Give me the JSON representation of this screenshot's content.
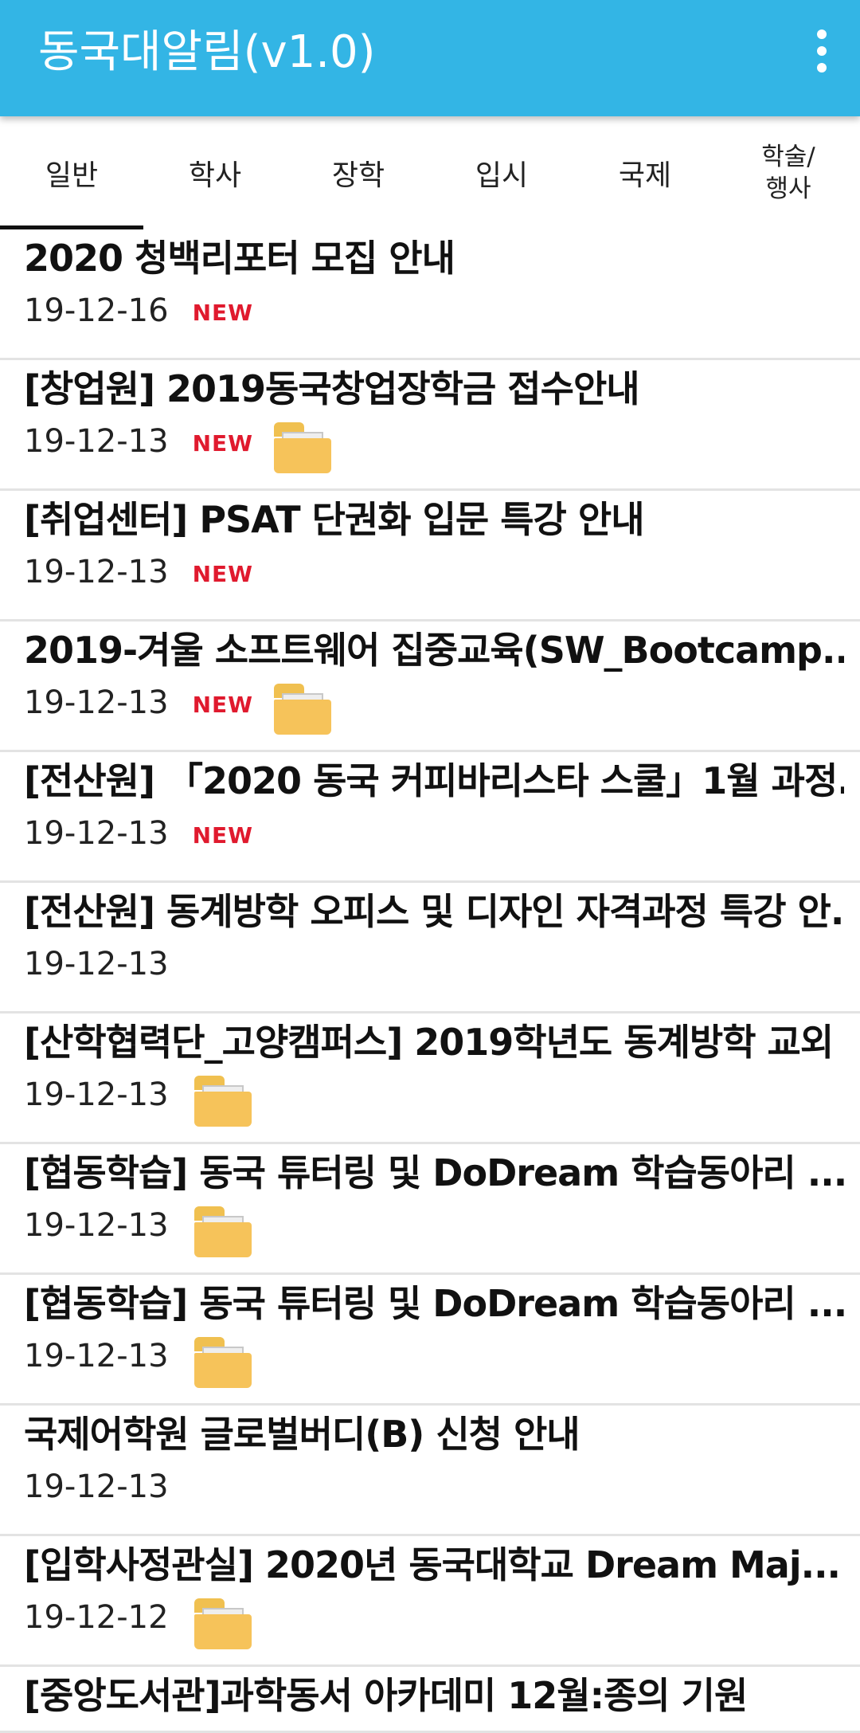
{
  "app": {
    "title": "동국대알림(v1.0)",
    "theme_color": "#33b5e5"
  },
  "menu": {
    "icon": "more-vert-icon"
  },
  "tabs": [
    {
      "label": "일반",
      "selected": true
    },
    {
      "label": "학사",
      "selected": false
    },
    {
      "label": "장학",
      "selected": false
    },
    {
      "label": "입시",
      "selected": false
    },
    {
      "label": "국제",
      "selected": false
    },
    {
      "label": "학술/\n행사",
      "selected": false
    }
  ],
  "notices": [
    {
      "title": "2020 청백리포터 모집 안내",
      "date": "19-12-16",
      "new": true,
      "attachment": false
    },
    {
      "title": "[창업원] 2019동국창업장학금 접수안내",
      "date": "19-12-13",
      "new": true,
      "attachment": true
    },
    {
      "title": "[취업센터] PSAT 단권화 입문 특강 안내",
      "date": "19-12-13",
      "new": true,
      "attachment": false
    },
    {
      "title": "2019-겨울 소프트웨어 집중교육(SW_Bootcamp...",
      "date": "19-12-13",
      "new": true,
      "attachment": true
    },
    {
      "title": "[전산원] 「2020 동국 커피바리스타 스쿨」1월 과정...",
      "date": "19-12-13",
      "new": true,
      "attachment": false
    },
    {
      "title": "[전산원] 동계방학 오피스 및 디자인 자격과정 특강 안...",
      "date": "19-12-13",
      "new": false,
      "attachment": false
    },
    {
      "title": "[산학협력단_고양캠퍼스] 2019학년도 동계방학 교외 ...",
      "date": "19-12-13",
      "new": false,
      "attachment": true
    },
    {
      "title": "[협동학습] 동국 튜터링 및 DoDream 학습동아리 ...",
      "date": "19-12-13",
      "new": false,
      "attachment": true
    },
    {
      "title": "[협동학습] 동국 튜터링 및 DoDream 학습동아리 ...",
      "date": "19-12-13",
      "new": false,
      "attachment": true
    },
    {
      "title": "국제어학원 글로벌버디(B) 신청 안내",
      "date": "19-12-13",
      "new": false,
      "attachment": false
    },
    {
      "title": "[입학사정관실] 2020년 동국대학교 Dream Maj...",
      "date": "19-12-12",
      "new": false,
      "attachment": true
    },
    {
      "title": "[중앙도서관]과학동서 아카데미 12월:종의 기원",
      "date": "",
      "new": false,
      "attachment": false
    }
  ],
  "new_badge_label": "NEW",
  "new_badge_color": "#e01a2e",
  "attachment_icon": "folder-icon"
}
